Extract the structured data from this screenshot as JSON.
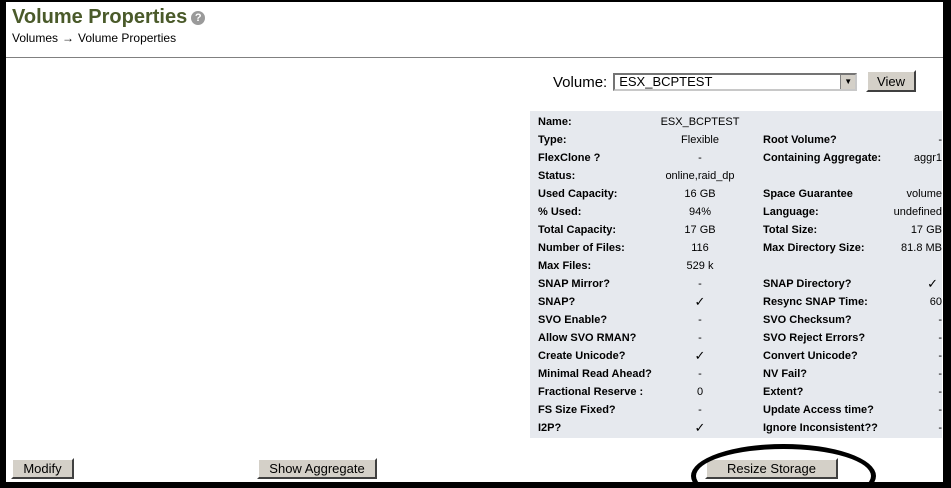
{
  "header": {
    "title": "Volume Properties",
    "help_glyph": "?",
    "breadcrumb": {
      "parent": "Volumes",
      "arrow": "→",
      "current": "Volume Properties"
    }
  },
  "selector": {
    "label": "Volume:",
    "selected": "ESX_BCPTEST",
    "view_label": "View"
  },
  "properties_left": [
    {
      "label": "Name:",
      "value": "ESX_BCPTEST"
    },
    {
      "label": "Type:",
      "value": "Flexible"
    },
    {
      "label": "FlexClone ?",
      "value": "-"
    },
    {
      "label": "Status:",
      "value": "online,raid_dp"
    },
    {
      "label": "Used Capacity:",
      "value": "16 GB"
    },
    {
      "label": "% Used:",
      "value": "94%"
    },
    {
      "label": "Total Capacity:",
      "value": "17 GB"
    },
    {
      "label": "Number of Files:",
      "value": "116"
    },
    {
      "label": "Max Files:",
      "value": "529 k"
    },
    {
      "label": "SNAP Mirror?",
      "value": "-"
    },
    {
      "label": "SNAP?",
      "value": "✓"
    },
    {
      "label": "SVO Enable?",
      "value": "-"
    },
    {
      "label": "Allow SVO RMAN?",
      "value": "-"
    },
    {
      "label": "Create Unicode?",
      "value": "✓"
    },
    {
      "label": "Minimal Read Ahead?",
      "value": "-"
    },
    {
      "label": "Fractional Reserve :",
      "value": "0"
    },
    {
      "label": "FS Size Fixed?",
      "value": "-"
    },
    {
      "label": "I2P?",
      "value": "✓"
    }
  ],
  "properties_right": [
    {
      "label": "",
      "value": ""
    },
    {
      "label": "Root Volume?",
      "value": "-"
    },
    {
      "label": "Containing Aggregate:",
      "value": "aggr1"
    },
    {
      "label": "",
      "value": ""
    },
    {
      "label": "Space Guarantee",
      "value": "volume"
    },
    {
      "label": "Language:",
      "value": "undefined"
    },
    {
      "label": "Total Size:",
      "value": "17 GB"
    },
    {
      "label": "Max Directory Size:",
      "value": "81.8 MB"
    },
    {
      "label": "",
      "value": ""
    },
    {
      "label": "SNAP Directory?",
      "value": "✓"
    },
    {
      "label": "Resync SNAP Time:",
      "value": "60"
    },
    {
      "label": "SVO Checksum?",
      "value": "-"
    },
    {
      "label": "SVO Reject Errors?",
      "value": "-"
    },
    {
      "label": "Convert Unicode?",
      "value": "-"
    },
    {
      "label": "NV Fail?",
      "value": "-"
    },
    {
      "label": "Extent?",
      "value": "-"
    },
    {
      "label": "Update Access time?",
      "value": "-"
    },
    {
      "label": "Ignore Inconsistent??",
      "value": "-"
    }
  ],
  "actions": {
    "modify": "Modify",
    "show_aggregate": "Show Aggregate",
    "resize_storage": "Resize Storage"
  },
  "colors": {
    "title": "#4a5a2a",
    "panel_bg": "#e6e9ee",
    "highlight_ring": "#000000"
  }
}
